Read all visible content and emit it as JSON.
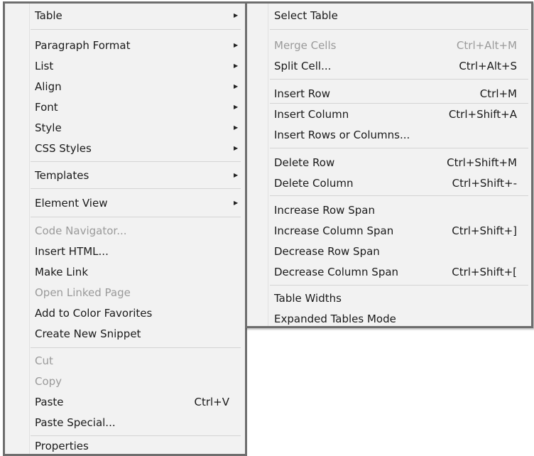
{
  "main_menu": {
    "table": "Table",
    "paragraph_format": "Paragraph Format",
    "list": "List",
    "align": "Align",
    "font": "Font",
    "style": "Style",
    "css_styles": "CSS Styles",
    "templates": "Templates",
    "element_view": "Element View",
    "code_navigator": "Code Navigator...",
    "insert_html": "Insert HTML...",
    "make_link": "Make Link",
    "open_linked_page": "Open Linked Page",
    "add_to_color_favorites": "Add to Color Favorites",
    "create_new_snippet": "Create New Snippet",
    "cut": "Cut",
    "copy": "Copy",
    "paste": "Paste",
    "paste_shortcut": "Ctrl+V",
    "paste_special": "Paste Special...",
    "properties": "Properties",
    "arrow": "▶"
  },
  "sub_menu": {
    "select_table": "Select Table",
    "merge_cells": "Merge Cells",
    "merge_cells_shortcut": "Ctrl+Alt+M",
    "split_cell": "Split Cell...",
    "split_cell_shortcut": "Ctrl+Alt+S",
    "insert_row": "Insert Row",
    "insert_row_shortcut": "Ctrl+M",
    "insert_column": "Insert Column",
    "insert_column_shortcut": "Ctrl+Shift+A",
    "insert_rows_or_columns": "Insert Rows or Columns...",
    "delete_row": "Delete Row",
    "delete_row_shortcut": "Ctrl+Shift+M",
    "delete_column": "Delete Column",
    "delete_column_shortcut": "Ctrl+Shift+-",
    "increase_row_span": "Increase Row Span",
    "increase_column_span": "Increase Column Span",
    "increase_column_span_shortcut": "Ctrl+Shift+]",
    "decrease_row_span": "Decrease Row Span",
    "decrease_column_span": "Decrease Column Span",
    "decrease_column_span_shortcut": "Ctrl+Shift+[",
    "table_widths": "Table Widths",
    "expanded_tables_mode": "Expanded Tables Mode"
  }
}
